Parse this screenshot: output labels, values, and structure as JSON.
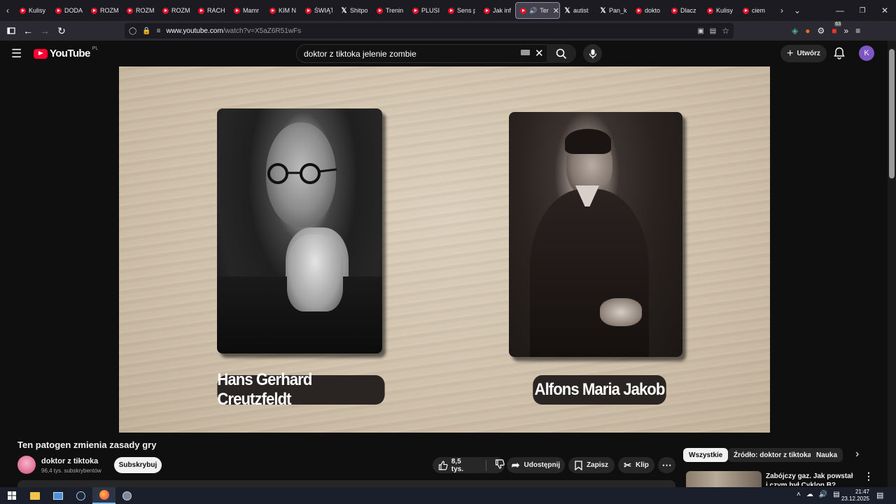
{
  "browser": {
    "tabs": [
      {
        "label": "Kulisy",
        "icon": "youtube-icon"
      },
      {
        "label": "DODA",
        "icon": "youtube-icon"
      },
      {
        "label": "ROZM",
        "icon": "youtube-icon"
      },
      {
        "label": "ROZM",
        "icon": "youtube-icon"
      },
      {
        "label": "ROZM",
        "icon": "youtube-icon"
      },
      {
        "label": "RACH",
        "icon": "youtube-icon"
      },
      {
        "label": "Mamr",
        "icon": "youtube-icon"
      },
      {
        "label": "KIM N",
        "icon": "youtube-icon"
      },
      {
        "label": "ŚWIĄT",
        "icon": "youtube-icon"
      },
      {
        "label": "Shitpo",
        "icon": "x-icon"
      },
      {
        "label": "Trenin",
        "icon": "youtube-icon"
      },
      {
        "label": "PLUSII",
        "icon": "youtube-icon"
      },
      {
        "label": "Sens p",
        "icon": "youtube-icon"
      },
      {
        "label": "Jak inf",
        "icon": "youtube-icon"
      },
      {
        "label": "Ten",
        "icon": "youtube-icon",
        "active": true
      },
      {
        "label": "autist",
        "icon": "x-icon"
      },
      {
        "label": "Pan_k",
        "icon": "x-icon"
      },
      {
        "label": "dokto",
        "icon": "youtube-icon"
      },
      {
        "label": "Dlacz",
        "icon": "youtube-icon"
      },
      {
        "label": "Kulisy",
        "icon": "youtube-icon"
      },
      {
        "label": "ciem",
        "icon": "youtube-icon"
      }
    ],
    "url_host": "www.youtube.com",
    "url_path": "/watch?v=X5aZ6R51wFs",
    "extension_badge": "63"
  },
  "youtube": {
    "logo_text": "YouTube",
    "country_code": "PL",
    "search_value": "doktor z tiktoka jelenie zombie",
    "create_label": "Utwórz",
    "avatar_letter": "K"
  },
  "video": {
    "left_name": "Hans Gerhard Creutzfeldt",
    "right_name": "Alfons Maria Jakob"
  },
  "watch": {
    "title": "Ten patogen zmienia zasady gry",
    "channel_name": "doktor z tiktoka",
    "channel_subs": "96,4 tys. subskrybentów",
    "subscribe_label": "Subskrybuj",
    "likes": "8,5 tys.",
    "share_label": "Udostępnij",
    "save_label": "Zapisz",
    "clip_label": "Klip"
  },
  "sidebar": {
    "chips": [
      "Wszystkie",
      "Źródło: doktor z tiktoka",
      "Nauka"
    ],
    "rec_title": "Zabójczy gaz. Jak powstał i czym był Cyklon B?"
  },
  "taskbar": {
    "time": "21:47",
    "date": "23.12.2025"
  }
}
